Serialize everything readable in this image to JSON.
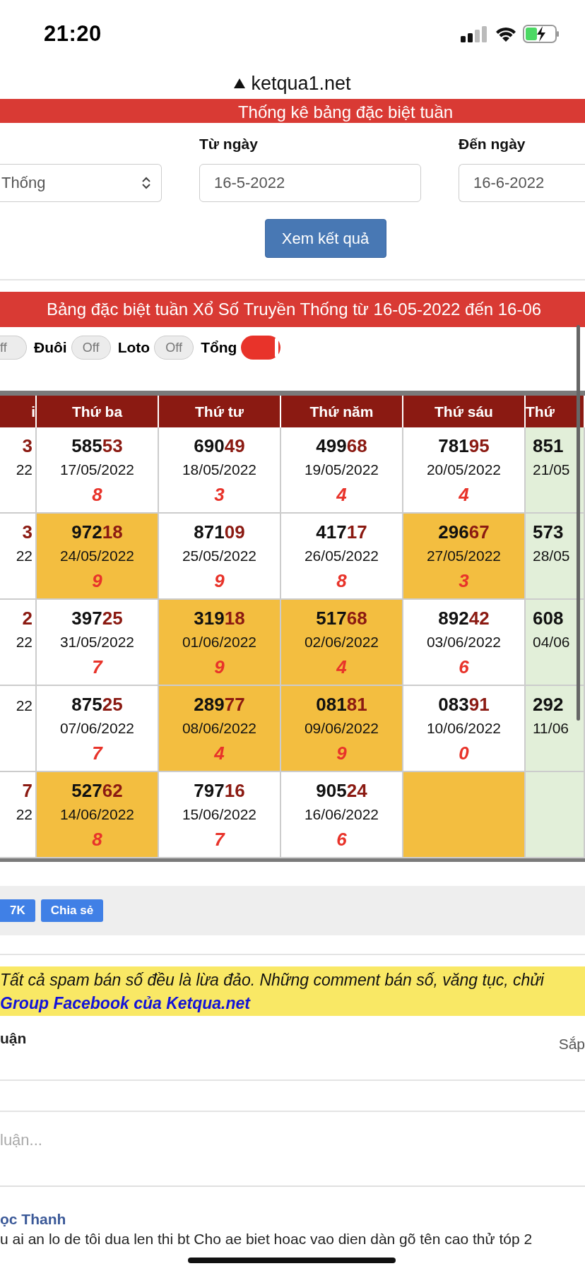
{
  "status_bar": {
    "time": "21:20"
  },
  "address_bar": {
    "url": "ketqua1.net"
  },
  "page_header": {
    "title": "Thống kê bảng đặc biệt tuần"
  },
  "form": {
    "select": {
      "value": "Thống"
    },
    "fields": [
      {
        "label": "Từ ngày",
        "value": "16-5-2022"
      },
      {
        "label": "Đến ngày",
        "value": "16-6-2022"
      }
    ],
    "submit": "Xem kết quả"
  },
  "banner": {
    "title": "Bảng đặc biệt tuần Xổ Số Truyền Thống từ 16-05-2022 đến 16-06"
  },
  "toggles": [
    {
      "switch": {
        "on": false,
        "text": "ff"
      }
    },
    {
      "label": "Đuôi",
      "switch": {
        "on": false,
        "text": "Off"
      }
    },
    {
      "label": "Loto",
      "switch": {
        "on": false,
        "text": "Off"
      }
    },
    {
      "label": "Tổng",
      "switch": {
        "on": true
      }
    }
  ],
  "table": {
    "columns": [
      {
        "label": "i",
        "kind": "cut-left",
        "weekend": false
      },
      {
        "label": "Thứ ba",
        "kind": "full",
        "weekend": false
      },
      {
        "label": "Thứ tư",
        "kind": "full",
        "weekend": false
      },
      {
        "label": "Thứ năm",
        "kind": "full",
        "weekend": false
      },
      {
        "label": "Thứ sáu",
        "kind": "full",
        "weekend": false
      },
      {
        "label": "Thứ",
        "kind": "cut-right",
        "weekend": true
      }
    ],
    "rows": [
      [
        {
          "tail": "3",
          "date": "22",
          "highlighted": false
        },
        {
          "head": "585",
          "tail": "53",
          "date": "17/05/2022",
          "sum": "8",
          "highlighted": false
        },
        {
          "head": "690",
          "tail": "49",
          "date": "18/05/2022",
          "sum": "3",
          "highlighted": false
        },
        {
          "head": "499",
          "tail": "68",
          "date": "19/05/2022",
          "sum": "4",
          "highlighted": false
        },
        {
          "head": "781",
          "tail": "95",
          "date": "20/05/2022",
          "sum": "4",
          "highlighted": false
        },
        {
          "head": "851",
          "date": "21/05",
          "highlighted": false
        }
      ],
      [
        {
          "tail": "3",
          "date": "22",
          "highlighted": false
        },
        {
          "head": "972",
          "tail": "18",
          "date": "24/05/2022",
          "sum": "9",
          "highlighted": true
        },
        {
          "head": "871",
          "tail": "09",
          "date": "25/05/2022",
          "sum": "9",
          "highlighted": false
        },
        {
          "head": "417",
          "tail": "17",
          "date": "26/05/2022",
          "sum": "8",
          "highlighted": false
        },
        {
          "head": "296",
          "tail": "67",
          "date": "27/05/2022",
          "sum": "3",
          "highlighted": true
        },
        {
          "head": "573",
          "date": "28/05",
          "highlighted": false
        }
      ],
      [
        {
          "tail": "2",
          "date": "22",
          "highlighted": false
        },
        {
          "head": "397",
          "tail": "25",
          "date": "31/05/2022",
          "sum": "7",
          "highlighted": false
        },
        {
          "head": "319",
          "tail": "18",
          "date": "01/06/2022",
          "sum": "9",
          "highlighted": true
        },
        {
          "head": "517",
          "tail": "68",
          "date": "02/06/2022",
          "sum": "4",
          "highlighted": true
        },
        {
          "head": "892",
          "tail": "42",
          "date": "03/06/2022",
          "sum": "6",
          "highlighted": false
        },
        {
          "head": "608",
          "date": "04/06",
          "highlighted": false
        }
      ],
      [
        {
          "date": "22",
          "highlighted": false
        },
        {
          "head": "875",
          "tail": "25",
          "date": "07/06/2022",
          "sum": "7",
          "highlighted": false
        },
        {
          "head": "289",
          "tail": "77",
          "date": "08/06/2022",
          "sum": "4",
          "highlighted": true
        },
        {
          "head": "081",
          "tail": "81",
          "date": "09/06/2022",
          "sum": "9",
          "highlighted": true
        },
        {
          "head": "083",
          "tail": "91",
          "date": "10/06/2022",
          "sum": "0",
          "highlighted": false
        },
        {
          "head": "292",
          "date": "11/06",
          "highlighted": false
        }
      ],
      [
        {
          "tail": "7",
          "date": "22",
          "highlighted": false
        },
        {
          "head": "527",
          "tail": "62",
          "date": "14/06/2022",
          "sum": "8",
          "highlighted": true
        },
        {
          "head": "797",
          "tail": "16",
          "date": "15/06/2022",
          "sum": "7",
          "highlighted": false
        },
        {
          "head": "905",
          "tail": "24",
          "date": "16/06/2022",
          "sum": "6",
          "highlighted": false
        },
        {
          "highlighted": true
        },
        {
          "highlighted": false
        }
      ]
    ]
  },
  "share_bar": {
    "buttons": [
      "7K",
      "Chia sẻ"
    ]
  },
  "notice": {
    "text": "Tất cả spam bán số đều là lừa đảo. Những comment bán số, văng tục, chửi",
    "link": "Group Facebook của Ketqua.net"
  },
  "comments": {
    "heading": "uận",
    "sort": "Sắp",
    "placeholder": "luận...",
    "items": [
      {
        "author": "ọc Thanh",
        "text": "u ai an lo de tôi dua len thi bt Cho ae biet hoac vao dien dàn gõ tên cao thử tóp 2"
      }
    ]
  }
}
